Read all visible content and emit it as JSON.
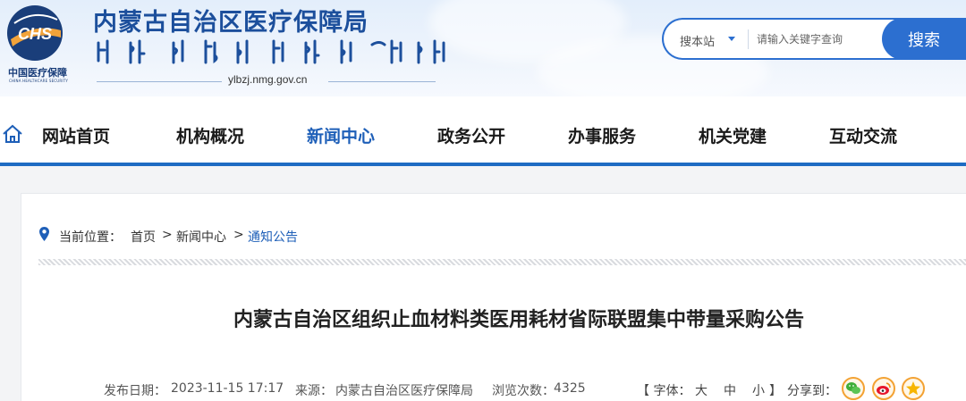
{
  "header": {
    "logo_cn": "中国医疗保障",
    "logo_en": "CHINA HEALTHCARE SECURITY",
    "logo_mark": "CHS",
    "site_title": "内蒙古自治区医疗保障局",
    "domain": "ylbzj.nmg.gov.cn"
  },
  "search": {
    "scope_label": "搜本站",
    "placeholder": "请输入关键字查询",
    "button_label": "搜索"
  },
  "nav": {
    "items": [
      {
        "label": "网站首页"
      },
      {
        "label": "机构概况"
      },
      {
        "label": "新闻中心",
        "active": true
      },
      {
        "label": "政务公开"
      },
      {
        "label": "办事服务"
      },
      {
        "label": "机关党建"
      },
      {
        "label": "互动交流"
      }
    ]
  },
  "breadcrumb": {
    "prefix": "当前位置：",
    "items": [
      "首页",
      "新闻中心",
      "通知公告"
    ],
    "separator": ">"
  },
  "article": {
    "title": "内蒙古自治区组织止血材料类医用耗材省际联盟集中带量采购公告",
    "meta": {
      "date_label": "发布日期：",
      "date": "2023-11-15 17:17",
      "source_label": "来源：",
      "source": "内蒙古自治区医疗保障局",
      "views_label": "浏览次数：",
      "views": "4325"
    },
    "font_size": {
      "open": "【 字体：",
      "large": "大",
      "medium": "中",
      "small": "小",
      "close": "】"
    },
    "share_label": "分享到："
  },
  "colors": {
    "brand_blue": "#1e5fb8",
    "nav_bar": "#1e6bc3",
    "search_blue": "#2c6fd0",
    "share_orange": "#f3a233"
  },
  "icons": [
    "home-icon",
    "location-pin-icon",
    "wechat-icon",
    "weibo-icon",
    "qzone-icon",
    "chs-emblem-icon"
  ]
}
